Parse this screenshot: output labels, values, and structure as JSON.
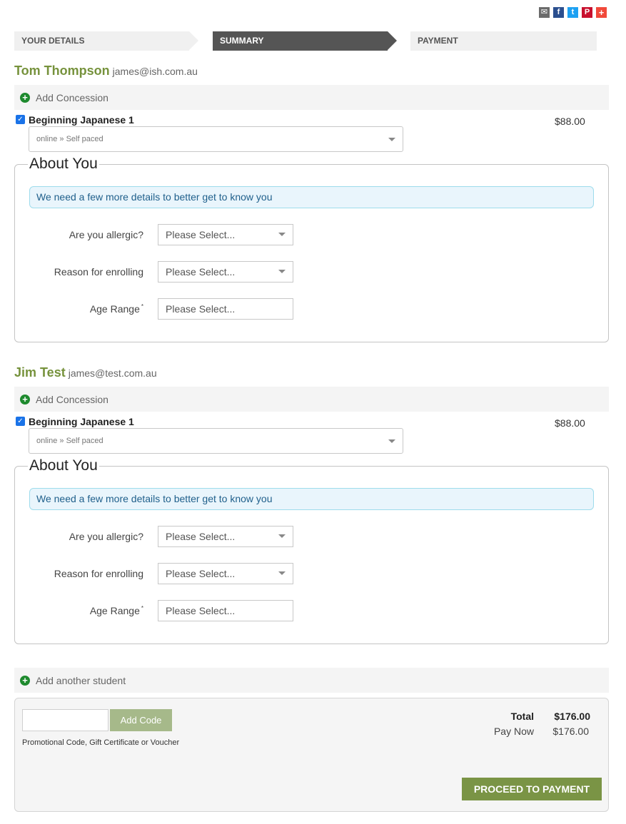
{
  "share": {
    "icons": [
      {
        "name": "email-icon",
        "glyph": "✉"
      },
      {
        "name": "facebook-icon",
        "glyph": "f"
      },
      {
        "name": "twitter-icon",
        "glyph": "t"
      },
      {
        "name": "pinterest-icon",
        "glyph": "P"
      },
      {
        "name": "share-plus-icon",
        "glyph": "+"
      }
    ]
  },
  "steps": [
    {
      "label": "YOUR DETAILS",
      "state": "done"
    },
    {
      "label": "SUMMARY",
      "state": "active"
    },
    {
      "label": "PAYMENT",
      "state": "pending"
    }
  ],
  "students": [
    {
      "name": "Tom Thompson",
      "email": "james@ish.com.au",
      "concession_label": "Add Concession",
      "course": {
        "checked": true,
        "title": "Beginning Japanese 1",
        "price": "$88.00",
        "class_option": "online » Self paced"
      },
      "about": {
        "legend": "About You",
        "info": "We need a few more details to better get to know you",
        "fields": [
          {
            "label": "Are you allergic?",
            "value": "Please Select...",
            "type": "select",
            "required": false
          },
          {
            "label": "Reason for enrolling",
            "value": "Please Select...",
            "type": "select",
            "required": false
          },
          {
            "label": "Age Range",
            "value": "Please Select...",
            "type": "input",
            "required": true
          }
        ]
      }
    },
    {
      "name": "Jim Test",
      "email": "james@test.com.au",
      "concession_label": "Add Concession",
      "course": {
        "checked": true,
        "title": "Beginning Japanese 1",
        "price": "$88.00",
        "class_option": "online » Self paced"
      },
      "about": {
        "legend": "About You",
        "info": "We need a few more details to better get to know you",
        "fields": [
          {
            "label": "Are you allergic?",
            "value": "Please Select...",
            "type": "select",
            "required": false
          },
          {
            "label": "Reason for enrolling",
            "value": "Please Select...",
            "type": "select",
            "required": false
          },
          {
            "label": "Age Range",
            "value": "Please Select...",
            "type": "input",
            "required": true
          }
        ]
      }
    }
  ],
  "required_marker": "*",
  "add_student_label": "Add another student",
  "summary": {
    "promo_value": "",
    "add_code_label": "Add Code",
    "promo_help": "Promotional Code, Gift Certificate or Voucher",
    "total_label": "Total",
    "total_value": "$176.00",
    "pay_now_label": "Pay Now",
    "pay_now_value": "$176.00",
    "proceed_label": "PROCEED TO PAYMENT"
  },
  "colors": {
    "brand_green": "#76923c",
    "button_green": "#7a9445",
    "add_code_green": "#a6b98a",
    "active_step": "#555555",
    "info_bg": "#e9f5fc",
    "info_text": "#1f5f8b",
    "plus_green": "#1e8a2e"
  }
}
